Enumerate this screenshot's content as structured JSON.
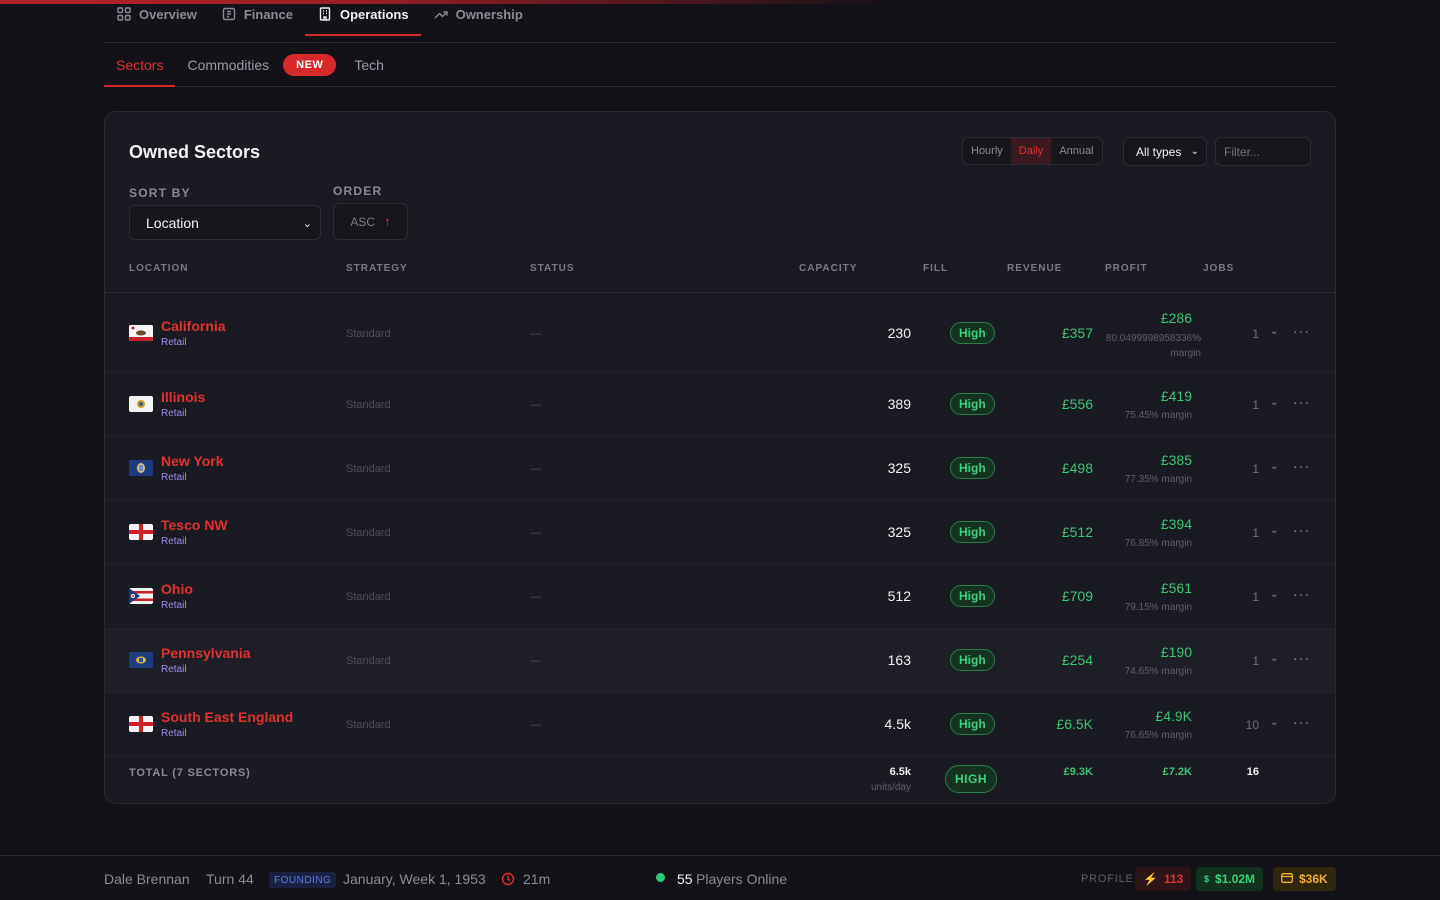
{
  "main_tabs": [
    {
      "label": "Overview",
      "icon": "grid-icon"
    },
    {
      "label": "Finance",
      "icon": "ledger-icon"
    },
    {
      "label": "Operations",
      "icon": "building-icon"
    },
    {
      "label": "Ownership",
      "icon": "trend-icon"
    }
  ],
  "active_main_tab": "Operations",
  "sub_tabs": {
    "sectors": "Sectors",
    "commodities": "Commodities",
    "new_badge": "NEW",
    "tech": "Tech"
  },
  "card": {
    "title": "Owned Sectors",
    "period_options": [
      "Hourly",
      "Daily",
      "Annual"
    ],
    "active_period": "Daily",
    "type_filter": "All types",
    "filter_placeholder": "Filter...",
    "sort_by_label": "SORT BY",
    "sort_by_value": "Location",
    "order_label": "ORDER",
    "order_value": "ASC",
    "order_arrow": "↑"
  },
  "columns": {
    "location": "LOCATION",
    "strategy": "STRATEGY",
    "status": "STATUS",
    "capacity": "CAPACITY",
    "fill": "FILL",
    "revenue": "REVENUE",
    "profit": "PROFIT",
    "jobs": "JOBS"
  },
  "rows": [
    {
      "name": "California",
      "type": "Retail",
      "strategy": "Standard",
      "status": "—",
      "capacity": "230",
      "fill": "High",
      "revenue": "£357",
      "profit": "£286",
      "margin": "80.0499998958336% margin",
      "jobs": "1"
    },
    {
      "name": "Illinois",
      "type": "Retail",
      "strategy": "Standard",
      "status": "—",
      "capacity": "389",
      "fill": "High",
      "revenue": "£556",
      "profit": "£419",
      "margin": "75.45% margin",
      "jobs": "1"
    },
    {
      "name": "New York",
      "type": "Retail",
      "strategy": "Standard",
      "status": "—",
      "capacity": "325",
      "fill": "High",
      "revenue": "£498",
      "profit": "£385",
      "margin": "77.35% margin",
      "jobs": "1"
    },
    {
      "name": "Tesco NW",
      "type": "Retail",
      "strategy": "Standard",
      "status": "—",
      "capacity": "325",
      "fill": "High",
      "revenue": "£512",
      "profit": "£394",
      "margin": "76.85% margin",
      "jobs": "1"
    },
    {
      "name": "Ohio",
      "type": "Retail",
      "strategy": "Standard",
      "status": "—",
      "capacity": "512",
      "fill": "High",
      "revenue": "£709",
      "profit": "£561",
      "margin": "79.15% margin",
      "jobs": "1"
    },
    {
      "name": "Pennsylvania",
      "type": "Retail",
      "strategy": "Standard",
      "status": "—",
      "capacity": "163",
      "fill": "High",
      "revenue": "£254",
      "profit": "£190",
      "margin": "74.65% margin",
      "jobs": "1"
    },
    {
      "name": "South East England",
      "type": "Retail",
      "strategy": "Standard",
      "status": "—",
      "capacity": "4.5k",
      "fill": "High",
      "revenue": "£6.5K",
      "profit": "£4.9K",
      "margin": "76.65% margin",
      "jobs": "10"
    }
  ],
  "total": {
    "label": "TOTAL (7 SECTORS)",
    "capacity": "6.5k",
    "unit": "units/day",
    "fill": "HIGH",
    "revenue": "£9.3K",
    "profit": "£7.2K",
    "jobs": "16"
  },
  "footer": {
    "player": "Dale Brennan",
    "turn": "Turn 44",
    "era_badge": "FOUNDING",
    "date": "January, Week 1, 1953",
    "timer": "21m",
    "online_count": "55",
    "online_label": "Players Online",
    "profile_label": "PROFILE",
    "energy": "113",
    "cash": "$1.02M",
    "credit": "$36K"
  },
  "colors": {
    "accent": "#e0302f",
    "positive": "#3ac46f",
    "retail_tag": "#a68cf0",
    "background": "#121218",
    "card": "#1a1a22"
  }
}
